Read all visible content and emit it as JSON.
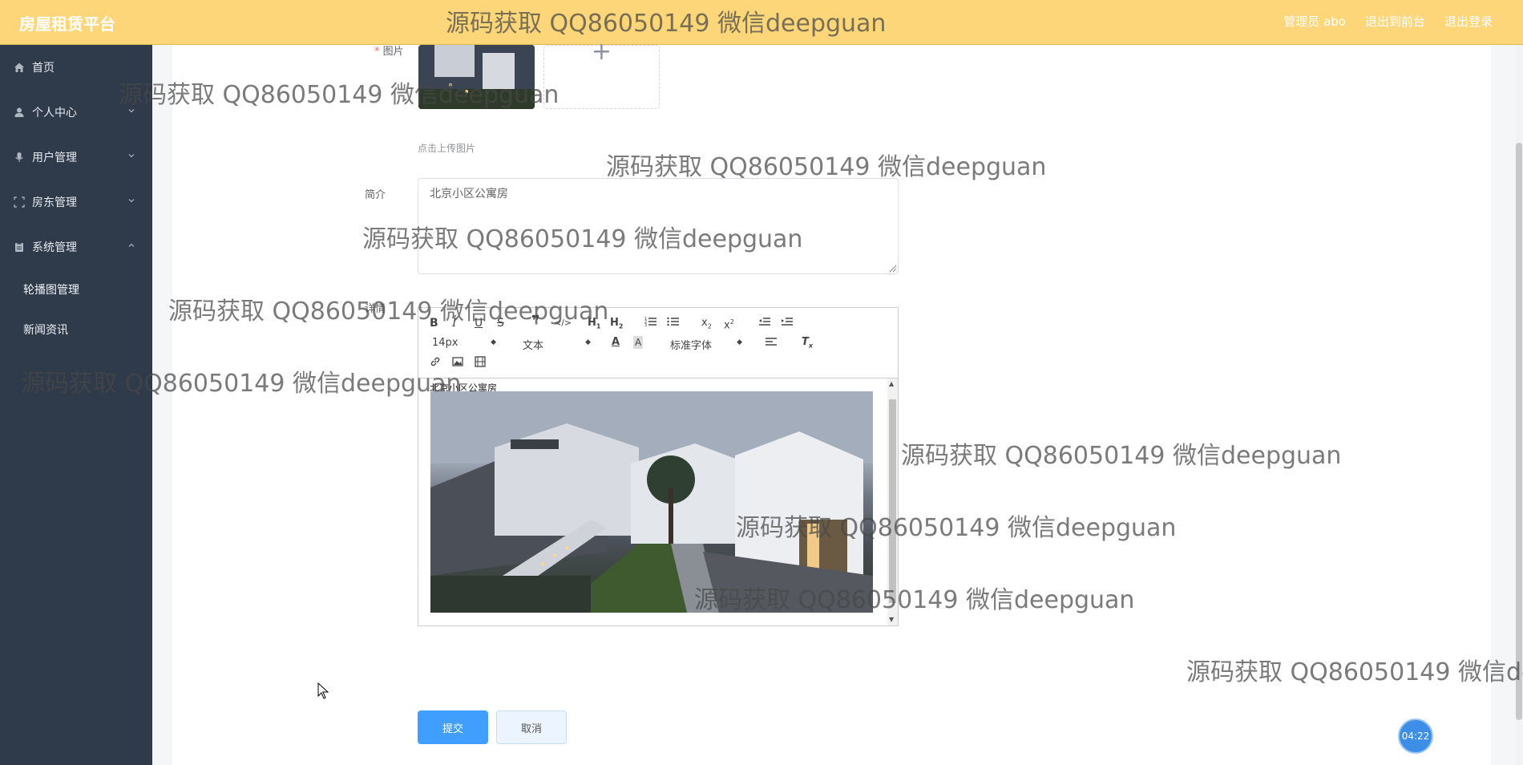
{
  "header": {
    "title": "房屋租赁平台",
    "links": [
      "管理员 abo",
      "退出到前台",
      "退出登录"
    ]
  },
  "sidebar": {
    "items": [
      {
        "label": "首页",
        "icon": "home-icon"
      },
      {
        "label": "个人中心",
        "icon": "user-icon"
      },
      {
        "label": "用户管理",
        "icon": "microphone-icon"
      },
      {
        "label": "房东管理",
        "icon": "frame-icon"
      },
      {
        "label": "系统管理",
        "icon": "clipboard-icon"
      }
    ],
    "subitems": [
      "轮播图管理",
      "新闻资讯"
    ]
  },
  "form": {
    "image_label": "图片",
    "upload_plus": "+",
    "upload_hint": "点击上传图片",
    "intro_label": "简介",
    "intro_value": "北京小区公寓房",
    "details_label": "详情",
    "editor": {
      "font_size": "14px",
      "paragraph": "文本",
      "font_family": "标准字体",
      "content_text": "北京小区公寓房"
    },
    "submit_label": "提交",
    "cancel_label": "取消"
  },
  "timer": "04:22",
  "watermark": "源码获取 QQ86050149 微信deepguan",
  "colors": {
    "header_bg": "#fcd679",
    "sidebar_bg": "#2f3a4a",
    "primary": "#409eff"
  }
}
